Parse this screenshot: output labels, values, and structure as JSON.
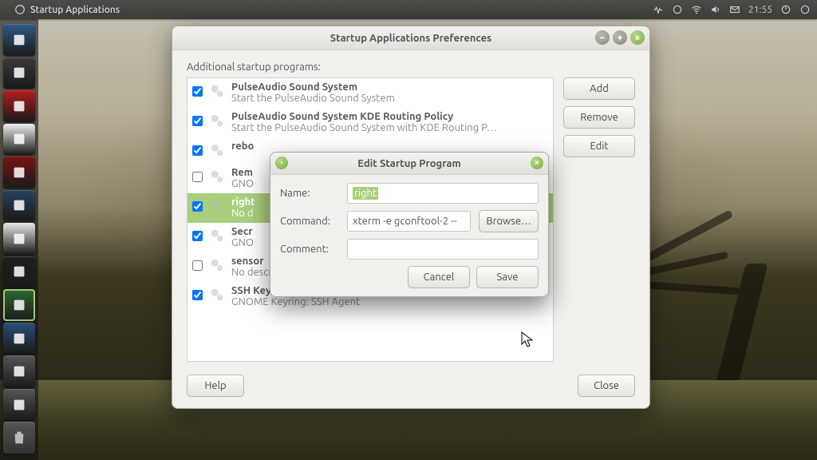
{
  "topbar": {
    "app_title": "Startup Applications",
    "time": "21:55"
  },
  "dock": {
    "items": [
      {
        "name": "files",
        "color": "#2f5a88"
      },
      {
        "name": "refresh",
        "color": "#3a3a3a"
      },
      {
        "name": "opera",
        "color": "#b31d1d"
      },
      {
        "name": "document",
        "color": "#ededed"
      },
      {
        "name": "reader",
        "color": "#781414"
      },
      {
        "name": "books",
        "color": "#27435e"
      },
      {
        "name": "media",
        "color": "#e6e6e6"
      },
      {
        "name": "terminal",
        "color": "#1e1e1e"
      },
      {
        "name": "startup",
        "color": "#2f6a33",
        "active": true
      },
      {
        "name": "display",
        "color": "#2a4f7a"
      },
      {
        "name": "keyring",
        "color": "#555"
      },
      {
        "name": "settings",
        "color": "#555"
      }
    ]
  },
  "window": {
    "title": "Startup Applications Preferences",
    "subtitle": "Additional startup programs:",
    "buttons": {
      "add": "Add",
      "remove": "Remove",
      "edit": "Edit",
      "help": "Help",
      "close": "Close"
    },
    "items": [
      {
        "checked": true,
        "title": "PulseAudio Sound System",
        "desc": "Start the PulseAudio Sound System"
      },
      {
        "checked": true,
        "title": "PulseAudio Sound System KDE Routing Policy",
        "desc": "Start the PulseAudio Sound System with KDE Routing P…"
      },
      {
        "checked": true,
        "title": "rebo",
        "desc": ""
      },
      {
        "checked": false,
        "title": "Rem",
        "desc": "GNO"
      },
      {
        "checked": true,
        "title": "right",
        "desc": "No d",
        "selected": true
      },
      {
        "checked": true,
        "title": "Secr",
        "desc": "GNO"
      },
      {
        "checked": false,
        "title": "sensor",
        "desc": "No description"
      },
      {
        "checked": true,
        "title": "SSH Key Agent",
        "desc": "GNOME Keyring: SSH Agent"
      }
    ]
  },
  "dialog": {
    "title": "Edit Startup Program",
    "labels": {
      "name": "Name:",
      "command": "Command:",
      "comment": "Comment:",
      "browse": "Browse…",
      "cancel": "Cancel",
      "save": "Save"
    },
    "values": {
      "name": "right",
      "command": "xterm -e gconftool-2 --",
      "comment": ""
    }
  }
}
